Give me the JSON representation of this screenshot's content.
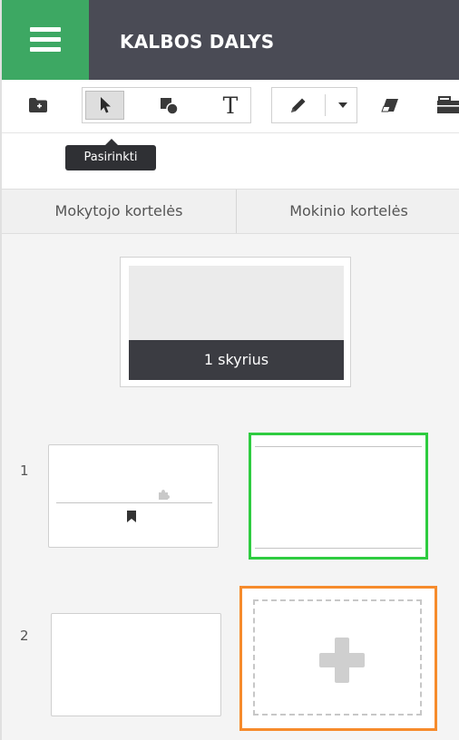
{
  "app": {
    "title": "KALBOS DALYS"
  },
  "toolbar": {
    "tools": [
      {
        "name": "add-folder",
        "icon": "folder-plus-icon"
      },
      {
        "name": "select",
        "icon": "cursor-arrow-icon",
        "active": true
      },
      {
        "name": "shapes",
        "icon": "shapes-icon"
      },
      {
        "name": "text",
        "icon": "text-T-icon",
        "glyph": "T"
      },
      {
        "name": "pen",
        "icon": "pencil-icon"
      },
      {
        "name": "pen-options",
        "icon": "caret-down-icon"
      },
      {
        "name": "eraser",
        "icon": "eraser-icon"
      },
      {
        "name": "toolbox",
        "icon": "toolbox-icon"
      }
    ]
  },
  "tooltip": {
    "text": "Pasirinkti"
  },
  "tabs": [
    {
      "label": "Mokytojo kortelės"
    },
    {
      "label": "Mokinio kortelės"
    }
  ],
  "chapter": {
    "label": "1 skyrius"
  },
  "rows": [
    {
      "number": "1"
    },
    {
      "number": "2"
    }
  ],
  "colors": {
    "header": "#4a4b55",
    "menu": "#3da863",
    "selected_outline": "#2ecc40",
    "add_outline": "#f68b2c"
  }
}
